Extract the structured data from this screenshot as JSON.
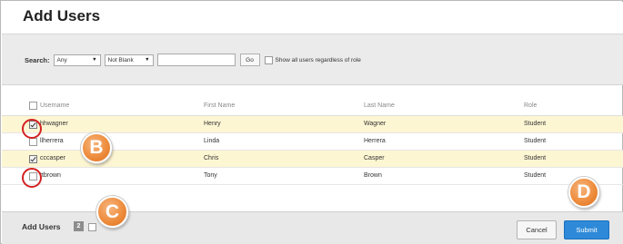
{
  "header": {
    "title": "Add Users"
  },
  "search": {
    "label": "Search:",
    "field_selected": "Any",
    "condition_selected": "Not Blank",
    "query_value": "",
    "go_label": "Go",
    "show_all_label": "Show all users regardless of role",
    "show_all_checked": false
  },
  "table": {
    "columns": [
      "Username",
      "First Name",
      "Last Name",
      "Role"
    ],
    "rows": [
      {
        "username": "hhwagner",
        "first": "Henry",
        "last": "Wagner",
        "role": "Student",
        "checked": true
      },
      {
        "username": "llherrera",
        "first": "Linda",
        "last": "Herrera",
        "role": "Student",
        "checked": false
      },
      {
        "username": "cccasper",
        "first": "Chris",
        "last": "Casper",
        "role": "Student",
        "checked": true
      },
      {
        "username": "ttbrown",
        "first": "Tony",
        "last": "Brown",
        "role": "Student",
        "checked": false
      }
    ]
  },
  "footer": {
    "label": "Add Users",
    "count": "2",
    "cancel_label": "Cancel",
    "submit_label": "Submit"
  },
  "callouts": {
    "b": "B",
    "c": "C",
    "d": "D"
  },
  "colors": {
    "selected_row": "#fdf6d3",
    "submit": "#2e8ad8",
    "callout": "#ee8d3e",
    "highlight_ring": "#d32222"
  },
  "icons": {
    "dropdown": "chevron-down-icon",
    "checkbox": "checkbox-icon"
  }
}
